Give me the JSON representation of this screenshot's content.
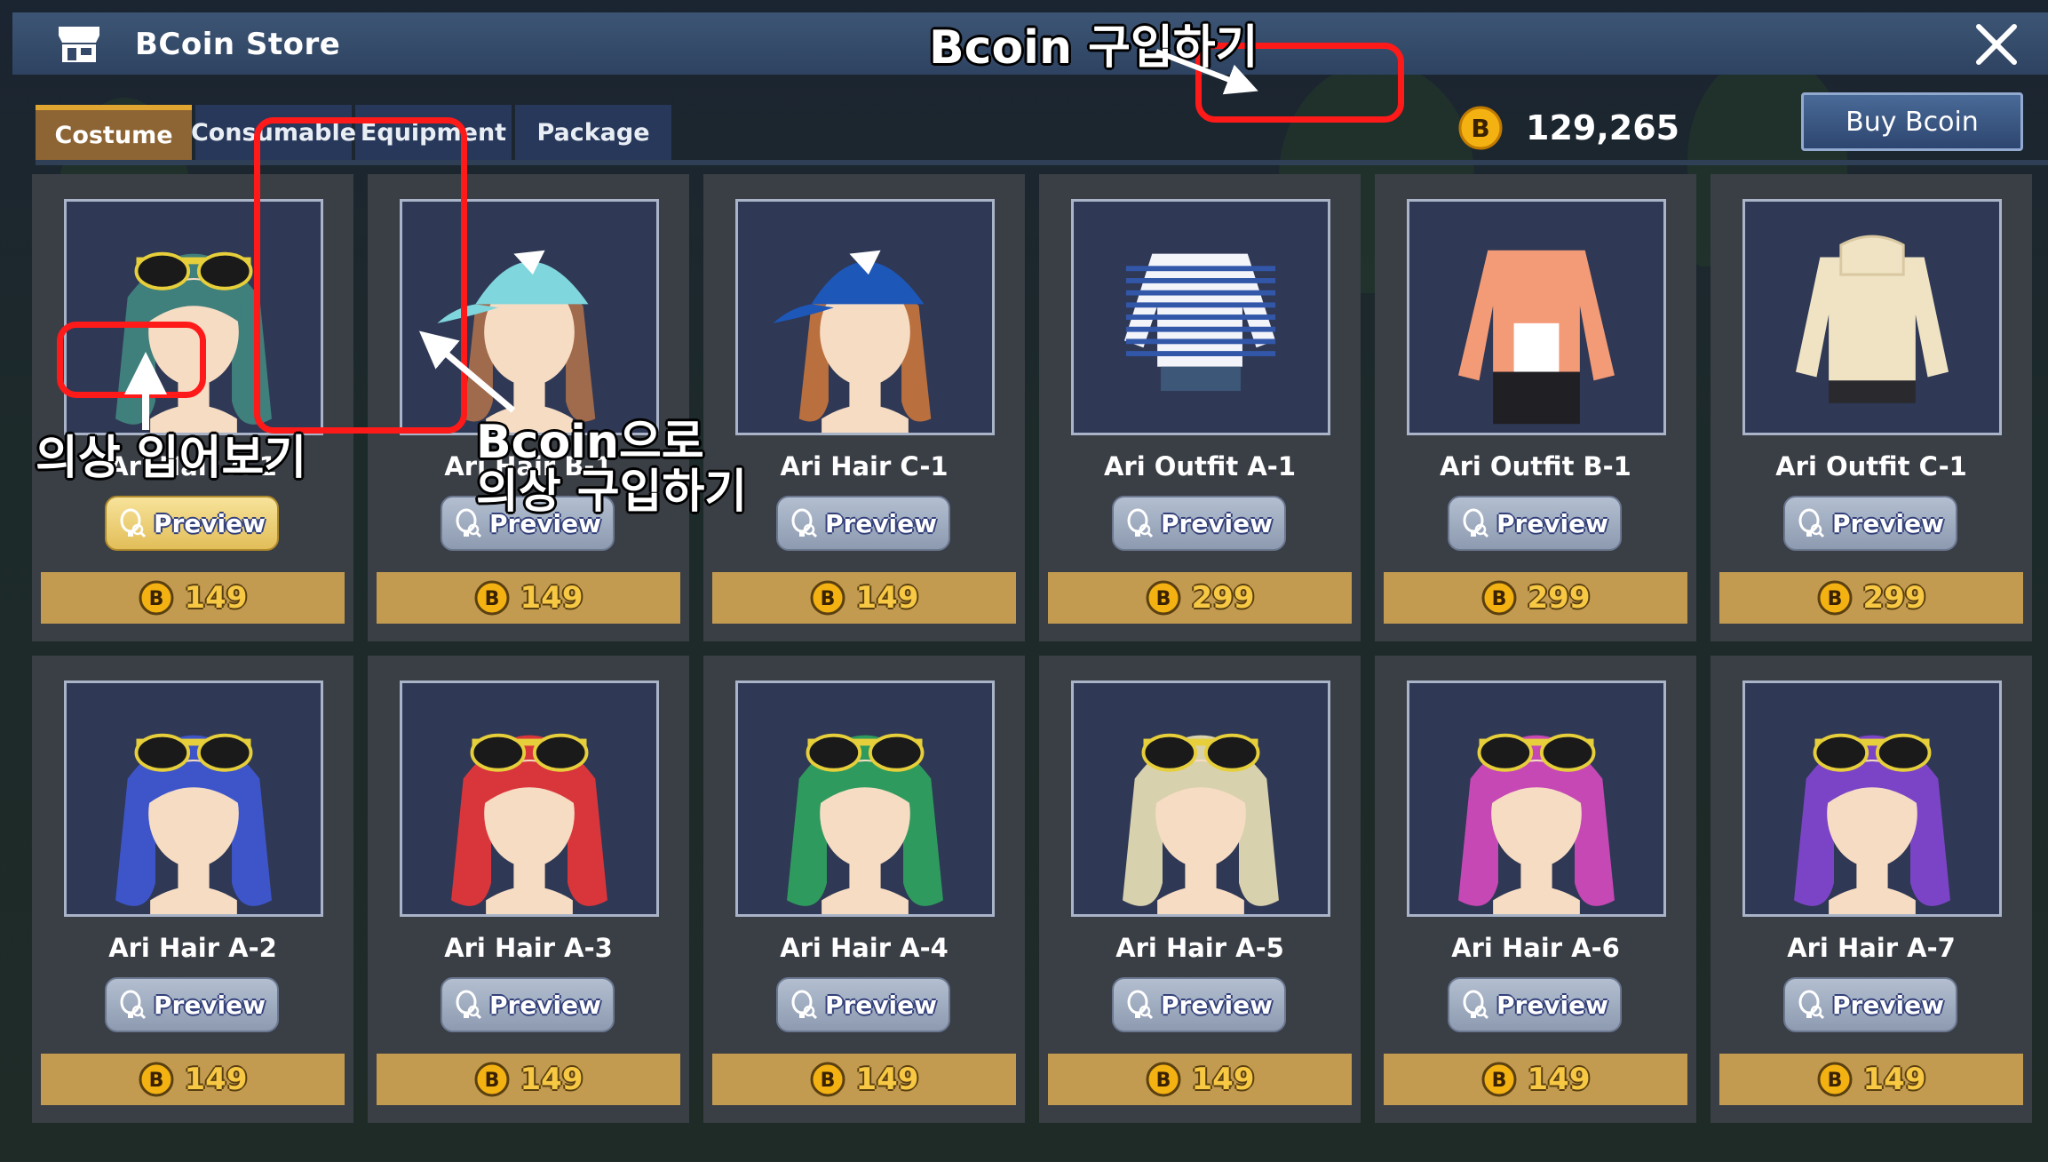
{
  "window": {
    "title": "BCoin Store",
    "close_icon": "close-icon",
    "store_icon": "store-icon"
  },
  "tabs": [
    {
      "label": "Costume",
      "active": true
    },
    {
      "label": "Consumable",
      "active": false
    },
    {
      "label": "Equipment",
      "active": false
    },
    {
      "label": "Package",
      "active": false
    }
  ],
  "balance": {
    "coin_icon": "bcoin-icon",
    "amount": "129,265"
  },
  "buy_button": {
    "label": "Buy Bcoin"
  },
  "items": [
    {
      "name": "Ari Hair A-1",
      "kind": "hair-glasses",
      "color": "#3f7f7c",
      "preview_label": "Preview",
      "preview_active": true,
      "price": "149"
    },
    {
      "name": "Ari Hair B-1",
      "kind": "hair-cap",
      "color": "#a06a4c",
      "cap_color": "#7fd6dd",
      "preview_label": "Preview",
      "preview_active": false,
      "price": "149"
    },
    {
      "name": "Ari Hair C-1",
      "kind": "hair-cap",
      "color": "#b96f3e",
      "cap_color": "#1d57b8",
      "preview_label": "Preview",
      "preview_active": false,
      "price": "149"
    },
    {
      "name": "Ari Outfit A-1",
      "kind": "outfit-striped",
      "color": "#f2f4fa",
      "preview_label": "Preview",
      "preview_active": false,
      "price": "299"
    },
    {
      "name": "Ari Outfit B-1",
      "kind": "outfit-jacket",
      "color": "#f39a76",
      "preview_label": "Preview",
      "preview_active": false,
      "price": "299"
    },
    {
      "name": "Ari Outfit C-1",
      "kind": "outfit-hoodie",
      "color": "#efe3c4",
      "preview_label": "Preview",
      "preview_active": false,
      "price": "299"
    },
    {
      "name": "Ari Hair A-2",
      "kind": "hair-glasses",
      "color": "#3d55c9",
      "preview_label": "Preview",
      "preview_active": false,
      "price": "149"
    },
    {
      "name": "Ari Hair A-3",
      "kind": "hair-glasses",
      "color": "#d9363c",
      "preview_label": "Preview",
      "preview_active": false,
      "price": "149"
    },
    {
      "name": "Ari Hair A-4",
      "kind": "hair-glasses",
      "color": "#2f9a5d",
      "preview_label": "Preview",
      "preview_active": false,
      "price": "149"
    },
    {
      "name": "Ari Hair A-5",
      "kind": "hair-glasses",
      "color": "#d8d1ad",
      "preview_label": "Preview",
      "preview_active": false,
      "price": "149"
    },
    {
      "name": "Ari Hair A-6",
      "kind": "hair-glasses",
      "color": "#c548b4",
      "preview_label": "Preview",
      "preview_active": false,
      "price": "149"
    },
    {
      "name": "Ari Hair A-7",
      "kind": "hair-glasses",
      "color": "#7b44c6",
      "preview_label": "Preview",
      "preview_active": false,
      "price": "149"
    }
  ],
  "annotations": {
    "buy_bcoin": "Bcoin 구입하기",
    "try_on": "의상 입어보기",
    "buy_with_bcoin": "Bcoin으로\n의상 구입하기",
    "highlight_color": "#ff1a1a"
  }
}
